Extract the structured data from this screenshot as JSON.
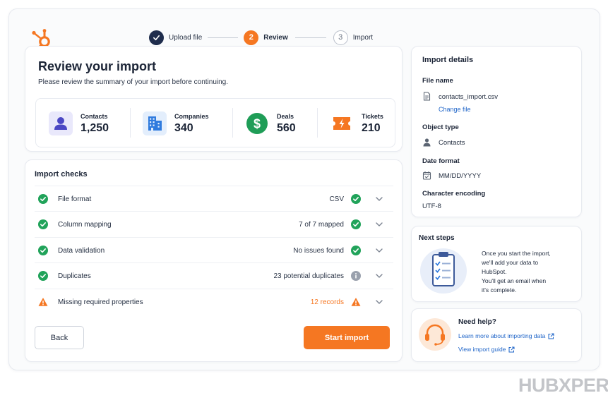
{
  "stepper": {
    "steps": [
      {
        "label": "Upload file",
        "number": "",
        "state": "done"
      },
      {
        "label": "Review",
        "number": "2",
        "state": "active"
      },
      {
        "label": "Import",
        "number": "3",
        "state": "todo"
      }
    ]
  },
  "review": {
    "title": "Review your import",
    "subtitle": "Please review the summary of your import before continuing.",
    "stats": [
      {
        "label": "Contacts",
        "value": "1,250",
        "icon": "person-icon"
      },
      {
        "label": "Companies",
        "value": "340",
        "icon": "building-icon"
      },
      {
        "label": "Deals",
        "value": "560",
        "icon": "dollar-icon"
      },
      {
        "label": "Tickets",
        "value": "210",
        "icon": "ticket-icon"
      }
    ]
  },
  "checks": {
    "title": "Import checks",
    "rows": [
      {
        "name": "File format",
        "value": "CSV",
        "status": "ok"
      },
      {
        "name": "Column mapping",
        "value": "7 of 7 mapped",
        "status": "ok"
      },
      {
        "name": "Data validation",
        "value": "No issues found",
        "status": "ok"
      },
      {
        "name": "Duplicates",
        "value": "23 potential duplicates",
        "status": "info"
      },
      {
        "name": "Missing required properties",
        "value": "12 records",
        "status": "warning"
      }
    ]
  },
  "actions": {
    "back_label": "Back",
    "start_label": "Start import"
  },
  "details": {
    "title": "Import details",
    "file_name_label": "File name",
    "file_name": "contacts_import.csv",
    "change_file_label": "Change file",
    "object_type_label": "Object type",
    "object_type": "Contacts",
    "date_format_label": "Date format",
    "date_format": "MM/DD/YYYY",
    "encoding_label": "Character encoding",
    "encoding": "UTF-8"
  },
  "next_steps": {
    "title": "Next steps",
    "lines": [
      "Once you start the import,",
      "we'll add your data to",
      "HubSpot.",
      "You'll get an email when",
      "it's complete."
    ]
  },
  "help": {
    "title": "Need help?",
    "link1": "Learn more about importing data",
    "link2": "View import guide"
  },
  "watermark": {
    "text": "HUBXPERT"
  },
  "colors": {
    "accent": "#f57722",
    "navy": "#1f2d4d",
    "success": "#21a35a",
    "info": "#9aa1ad",
    "link": "#1e64c8"
  }
}
